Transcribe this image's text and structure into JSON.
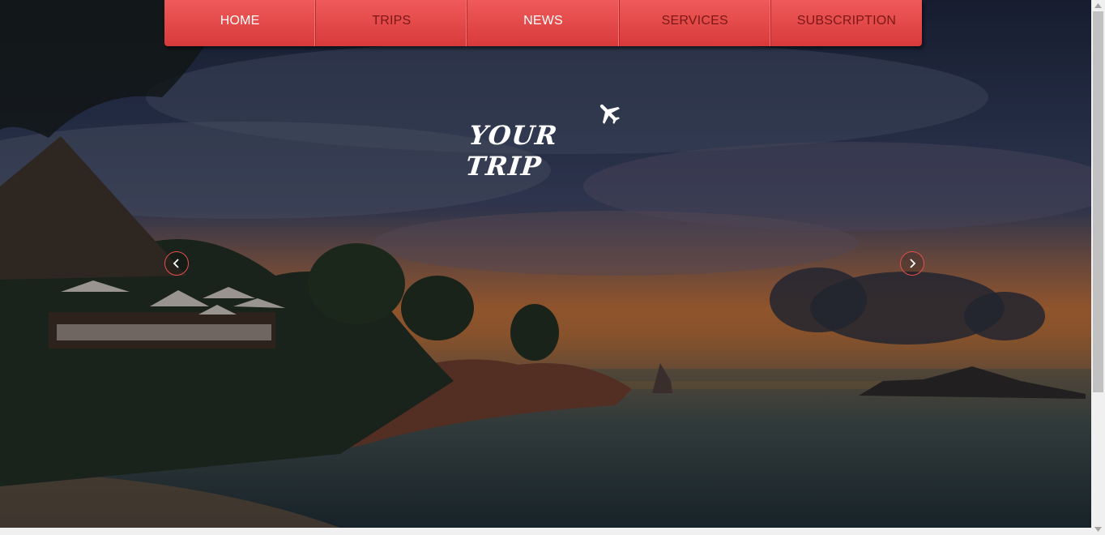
{
  "nav": {
    "items": [
      {
        "label": "HOME",
        "active": true
      },
      {
        "label": "TRIPS",
        "active": false
      },
      {
        "label": "NEWS",
        "active": true
      },
      {
        "label": "SERVICES",
        "active": false
      },
      {
        "label": "SUBSCRIPTION",
        "active": false
      }
    ]
  },
  "logo": {
    "text": "YOUR TRIP",
    "icon": "airplane-icon"
  },
  "slider": {
    "prev_icon": "chevron-left-icon",
    "next_icon": "chevron-right-icon"
  },
  "colors": {
    "nav_accent": "#e54848",
    "nav_text": "#7a1818",
    "nav_active": "#ffffff",
    "arrow_border": "#e4504f"
  }
}
